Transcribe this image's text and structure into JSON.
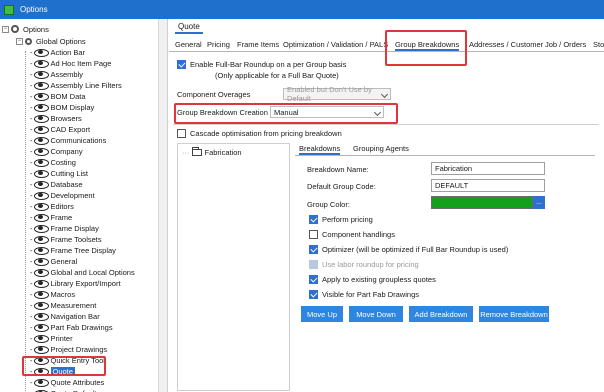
{
  "window": {
    "title": "Options"
  },
  "tree": {
    "root": "Options",
    "group": "Global Options",
    "items": [
      "Action Bar",
      "Ad Hoc Item Page",
      "Assembly",
      "Assembly Line Filters",
      "BOM Data",
      "BOM Display",
      "Browsers",
      "CAD Export",
      "Communications",
      "Company",
      "Costing",
      "Cutting List",
      "Database",
      "Development",
      "Editors",
      "Frame",
      "Frame Display",
      "Frame Toolsets",
      "Frame Tree Display",
      "General",
      "Global and Local Options",
      "Library Export/Import",
      "Macros",
      "Measurement",
      "Navigation Bar",
      "Part Fab Drawings",
      "Printer",
      "Project Drawings",
      "Quick Entry Tool",
      "Quote",
      "Quote Attributes",
      "Quote Default"
    ],
    "selected": "Quote"
  },
  "quote": {
    "section_title": "Quote",
    "tabs": [
      "General",
      "Pricing",
      "Frame Items",
      "Optimization / Validation / PALS",
      "Group Breakdowns",
      "Addresses / Customer",
      "Job / Orders",
      "Sto"
    ],
    "active_tab": "Group Breakdowns",
    "enable_roundup_label": "Enable Full-Bar Roundup on a per Group basis",
    "enable_roundup_note": "(Only applicable for a Full Bar Quote)",
    "component_overages_label": "Component Overages",
    "component_overages_value": "Enabled but Don't Use by Default",
    "group_breakdown_creation_label": "Group Breakdown Creation",
    "group_breakdown_creation_value": "Manual",
    "cascade_label": "Cascade optimisation from pricing breakdown",
    "tree_node": "Fabrication",
    "bd_tabs": [
      "Breakdowns",
      "Grouping Agents"
    ],
    "breakdown_name_label": "Breakdown Name:",
    "breakdown_name_value": "Fabrication",
    "default_group_code_label": "Default Group Code:",
    "default_group_code_value": "DEFAULT",
    "group_color_label": "Group Color:",
    "group_color": "#13a01d",
    "dots": "...",
    "checks": [
      {
        "label": "Perform pricing",
        "state": "on"
      },
      {
        "label": "Component handlings",
        "state": "off"
      },
      {
        "label": "Optimizer (will be optimized if Full Bar Roundup is used)",
        "state": "on"
      },
      {
        "label": "Use labor roundup for pricing",
        "state": "dis"
      },
      {
        "label": "Apply to existing groupless quotes",
        "state": "on"
      },
      {
        "label": "Visible for Part Fab Drawings",
        "state": "on"
      }
    ],
    "buttons": [
      "Move Up",
      "Move Down",
      "Add Breakdown",
      "Remove Breakdown"
    ]
  }
}
